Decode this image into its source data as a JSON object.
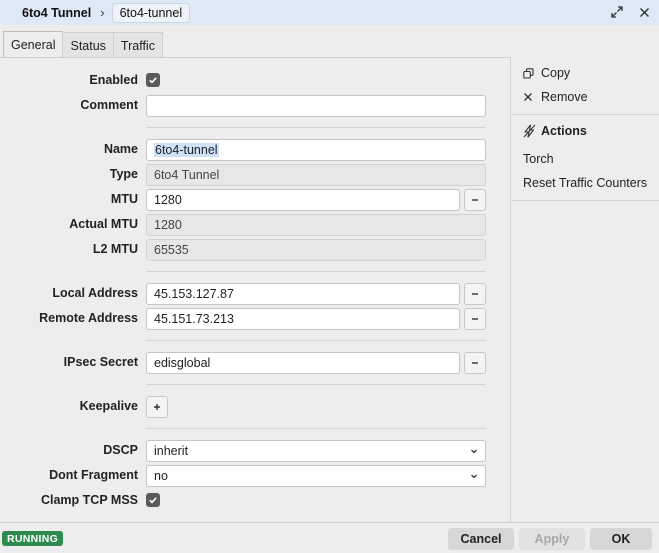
{
  "window": {
    "breadcrumb_main": "6to4 Tunnel",
    "breadcrumb_current": "6to4-tunnel",
    "separator": "›"
  },
  "tabs": [
    {
      "label": "General",
      "active": true
    },
    {
      "label": "Status",
      "active": false
    },
    {
      "label": "Traffic",
      "active": false
    }
  ],
  "form": {
    "enabled": {
      "label": "Enabled",
      "checked": true
    },
    "comment": {
      "label": "Comment",
      "value": ""
    },
    "name": {
      "label": "Name",
      "value": "6to4-tunnel"
    },
    "type": {
      "label": "Type",
      "value": "6to4 Tunnel"
    },
    "mtu": {
      "label": "MTU",
      "value": "1280"
    },
    "actual_mtu": {
      "label": "Actual MTU",
      "value": "1280"
    },
    "l2_mtu": {
      "label": "L2 MTU",
      "value": "65535"
    },
    "local_address": {
      "label": "Local Address",
      "value": "45.153.127.87"
    },
    "remote_address": {
      "label": "Remote Address",
      "value": "45.151.73.213"
    },
    "ipsec_secret": {
      "label": "IPsec Secret",
      "value": "edisglobal"
    },
    "keepalive": {
      "label": "Keepalive"
    },
    "dscp": {
      "label": "DSCP",
      "value": "inherit"
    },
    "dont_fragment": {
      "label": "Dont Fragment",
      "value": "no"
    },
    "clamp_tcp_mss": {
      "label": "Clamp TCP MSS",
      "checked": true
    }
  },
  "side": {
    "copy": "Copy",
    "remove": "Remove",
    "actions_heading": "Actions",
    "torch": "Torch",
    "reset_traffic": "Reset Traffic Counters"
  },
  "footer": {
    "status": "RUNNING",
    "cancel": "Cancel",
    "apply": "Apply",
    "ok": "OK"
  },
  "colors": {
    "titlebar": "#dde9f5",
    "running_badge": "#2e8b4f",
    "selection": "#cfe1f6"
  }
}
